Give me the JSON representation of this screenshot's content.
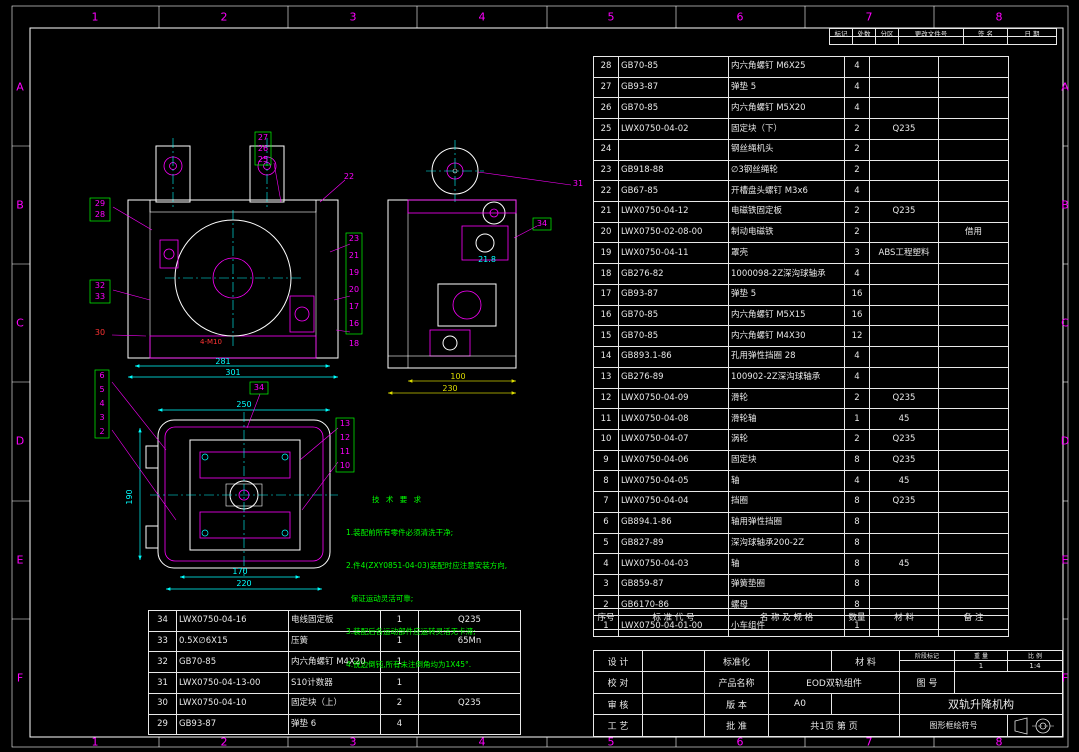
{
  "colors": {
    "background": "#000000",
    "frame": "#ffffff",
    "zone_label": "#ff00ff",
    "dimension": "#00ffff",
    "notes": "#00ff00",
    "detail": "#ff00ff"
  },
  "zones": {
    "top": [
      "1",
      "2",
      "3",
      "4",
      "5",
      "6",
      "7",
      "8"
    ],
    "bottom": [
      "1",
      "2",
      "3",
      "4",
      "5",
      "6",
      "7",
      "8"
    ],
    "left": [
      "A",
      "B",
      "C",
      "D",
      "E",
      "F"
    ],
    "right": [
      "A",
      "B",
      "C",
      "D",
      "E",
      "F"
    ]
  },
  "revision_strip": {
    "headers": [
      "标记",
      "处数",
      "分区",
      "更改文件号",
      "签 名",
      "日 期"
    ]
  },
  "bom": {
    "headers": [
      "序号",
      "标 准 代 号",
      "名 称 及 规 格",
      "数量",
      "材 料",
      "备 注"
    ],
    "rows": [
      {
        "no": "28",
        "code": "GB70-85",
        "name": "内六角螺钉 M6X25",
        "qty": "4",
        "material": "",
        "note": ""
      },
      {
        "no": "27",
        "code": "GB93-87",
        "name": "弹垫 5",
        "qty": "4",
        "material": "",
        "note": ""
      },
      {
        "no": "26",
        "code": "GB70-85",
        "name": "内六角螺钉 M5X20",
        "qty": "4",
        "material": "",
        "note": ""
      },
      {
        "no": "25",
        "code": "LWX0750-04-02",
        "name": "固定块（下）",
        "qty": "2",
        "material": "Q235",
        "note": ""
      },
      {
        "no": "24",
        "code": "",
        "name": "钢丝绳机头",
        "qty": "2",
        "material": "",
        "note": ""
      },
      {
        "no": "23",
        "code": "GB918-88",
        "name": "∅3钢丝绳轮",
        "qty": "2",
        "material": "",
        "note": ""
      },
      {
        "no": "22",
        "code": "GB67-85",
        "name": "开槽盘头螺钉 M3x6",
        "qty": "4",
        "material": "",
        "note": ""
      },
      {
        "no": "21",
        "code": "LWX0750-04-12",
        "name": "电磁铁固定板",
        "qty": "2",
        "material": "Q235",
        "note": ""
      },
      {
        "no": "20",
        "code": "LWX0750-02-08-00",
        "name": "制动电磁铁",
        "qty": "2",
        "material": "",
        "note": "借用"
      },
      {
        "no": "19",
        "code": "LWX0750-04-11",
        "name": "罩壳",
        "qty": "3",
        "material": "ABS工程塑料",
        "note": ""
      },
      {
        "no": "18",
        "code": "GB276-82",
        "name": "1000098-2Z深沟球轴承",
        "qty": "4",
        "material": "",
        "note": ""
      },
      {
        "no": "17",
        "code": "GB93-87",
        "name": "弹垫 5",
        "qty": "16",
        "material": "",
        "note": ""
      },
      {
        "no": "16",
        "code": "GB70-85",
        "name": "内六角螺钉 M5X15",
        "qty": "16",
        "material": "",
        "note": ""
      },
      {
        "no": "15",
        "code": "GB70-85",
        "name": "内六角螺钉 M4X30",
        "qty": "12",
        "material": "",
        "note": ""
      },
      {
        "no": "14",
        "code": "GB893.1-86",
        "name": "孔用弹性挡圈 28",
        "qty": "4",
        "material": "",
        "note": ""
      },
      {
        "no": "13",
        "code": "GB276-89",
        "name": "100902-2Z深沟球轴承",
        "qty": "4",
        "material": "",
        "note": ""
      },
      {
        "no": "12",
        "code": "LWX0750-04-09",
        "name": "滑轮",
        "qty": "2",
        "material": "Q235",
        "note": ""
      },
      {
        "no": "11",
        "code": "LWX0750-04-08",
        "name": "滑轮轴",
        "qty": "1",
        "material": "45",
        "note": ""
      },
      {
        "no": "10",
        "code": "LWX0750-04-07",
        "name": "涡轮",
        "qty": "2",
        "material": "Q235",
        "note": ""
      },
      {
        "no": "9",
        "code": "LWX0750-04-06",
        "name": "固定块",
        "qty": "8",
        "material": "Q235",
        "note": ""
      },
      {
        "no": "8",
        "code": "LWX0750-04-05",
        "name": "轴",
        "qty": "4",
        "material": "45",
        "note": ""
      },
      {
        "no": "7",
        "code": "LWX0750-04-04",
        "name": "挡圈",
        "qty": "8",
        "material": "Q235",
        "note": ""
      },
      {
        "no": "6",
        "code": "GB894.1-86",
        "name": "轴用弹性挡圈",
        "qty": "8",
        "material": "",
        "note": ""
      },
      {
        "no": "5",
        "code": "GB827-89",
        "name": "深沟球轴承200-2Z",
        "qty": "8",
        "material": "",
        "note": ""
      },
      {
        "no": "4",
        "code": "LWX0750-04-03",
        "name": "轴",
        "qty": "8",
        "material": "45",
        "note": ""
      },
      {
        "no": "3",
        "code": "GB859-87",
        "name": "弹簧垫圈",
        "qty": "8",
        "material": "",
        "note": ""
      },
      {
        "no": "2",
        "code": "GB6170-86",
        "name": "螺母",
        "qty": "8",
        "material": "",
        "note": ""
      },
      {
        "no": "1",
        "code": "LWX0750-04-01-00",
        "name": "小车组件",
        "qty": "1",
        "material": "",
        "note": ""
      }
    ]
  },
  "bom2": {
    "rows": [
      {
        "no": "34",
        "code": "LWX0750-04-16",
        "name": "电线固定板",
        "qty": "1",
        "material": "Q235"
      },
      {
        "no": "33",
        "code": "0.5X∅6X15",
        "name": "压簧",
        "qty": "1",
        "material": "65Mn"
      },
      {
        "no": "32",
        "code": "GB70-85",
        "name": "内六角螺钉 M4X20",
        "qty": "1",
        "material": ""
      },
      {
        "no": "31",
        "code": "LWX0750-04-13-00",
        "name": "S10计数器",
        "qty": "1",
        "material": ""
      },
      {
        "no": "30",
        "code": "LWX0750-04-10",
        "name": "固定块（上）",
        "qty": "2",
        "material": "Q235"
      },
      {
        "no": "29",
        "code": "GB93-87",
        "name": "弹垫 6",
        "qty": "4",
        "material": ""
      }
    ]
  },
  "title_block": {
    "design_label": "设 计",
    "check_label": "校 对",
    "review_label": "审 核",
    "process_label": "工 艺",
    "std_label": "标准化",
    "product_label": "产品名称",
    "product_value": "EOD双轨组件",
    "version_label": "版 本",
    "version_value": "A0",
    "approve_label": "批 准",
    "sheet_info": "共1页  第 页",
    "material_label": "材 料",
    "stage_label": "阶段标记",
    "weight_label": "重 量",
    "weight_value": "1",
    "scale_label": "比 例",
    "scale_value": "1:4",
    "drawing_no_label": "图 号",
    "title_value": "双轨升降机构",
    "fig_label": "图形框绘符号"
  },
  "tech_notes": {
    "title": "技 术 要 求",
    "lines": [
      "1.装配前所有零件必须清洗干净;",
      "2.件4(ZXY0851-04-03)装配时应注意安装方向,",
      "  保证运动灵活可靠;",
      "3.装配后各运动部件应运转灵活无卡滞;",
      "4.锐边倒钝,所有未注倒角均为1X45°."
    ]
  },
  "balloons": [
    "27",
    "26",
    "25",
    "29",
    "28",
    "32",
    "33",
    "30",
    "22",
    "23",
    "21",
    "19",
    "20",
    "17",
    "16",
    "18",
    "31",
    "34",
    "34",
    "6",
    "5",
    "4",
    "3",
    "2",
    "13",
    "12",
    "11",
    "10"
  ],
  "dims": {
    "v1": [
      "281",
      "301"
    ],
    "v2": [
      "21.8",
      "100",
      "230"
    ],
    "v3": [
      "250",
      "190",
      "170",
      "220"
    ]
  },
  "red_note": "4-M10"
}
